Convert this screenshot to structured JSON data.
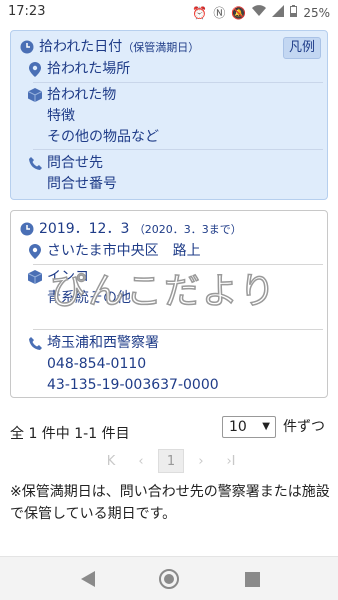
{
  "statusbar": {
    "time": "17:23",
    "battery": "25%"
  },
  "legend": {
    "button_label": "凡例",
    "date_label": "拾われた日付",
    "date_note": "（保管満期日）",
    "place_label": "拾われた場所",
    "item_label": "拾われた物",
    "feature_label": "特徴",
    "other_label": "その他の物品など",
    "contact_label": "問合せ先",
    "contact_no_label": "問合せ番号"
  },
  "result": {
    "date": "2019．12．3",
    "expiry": "（2020．3．3まで）",
    "place": "さいたま市中央区　路上",
    "item": "インコ",
    "feature": "青系統その他",
    "contact": "埼玉浦和西警察署",
    "phone": "048-854-0110",
    "contact_no": "43-135-19-003637-0000"
  },
  "watermark": "ぴんこだより",
  "pagination": {
    "count_text": "全 1 件中 1-1 件目",
    "per_page_value": "10",
    "per_page_label": "件ずつ",
    "first": "K",
    "prev": "‹",
    "current": "1",
    "next": "›",
    "last": "›I"
  },
  "note": "※保管満期日は、問い合わせ先の警察署または施設で保管している期日です。",
  "colors": {
    "accent": "#1f3c88",
    "legend_bg": "#dfecfb"
  }
}
